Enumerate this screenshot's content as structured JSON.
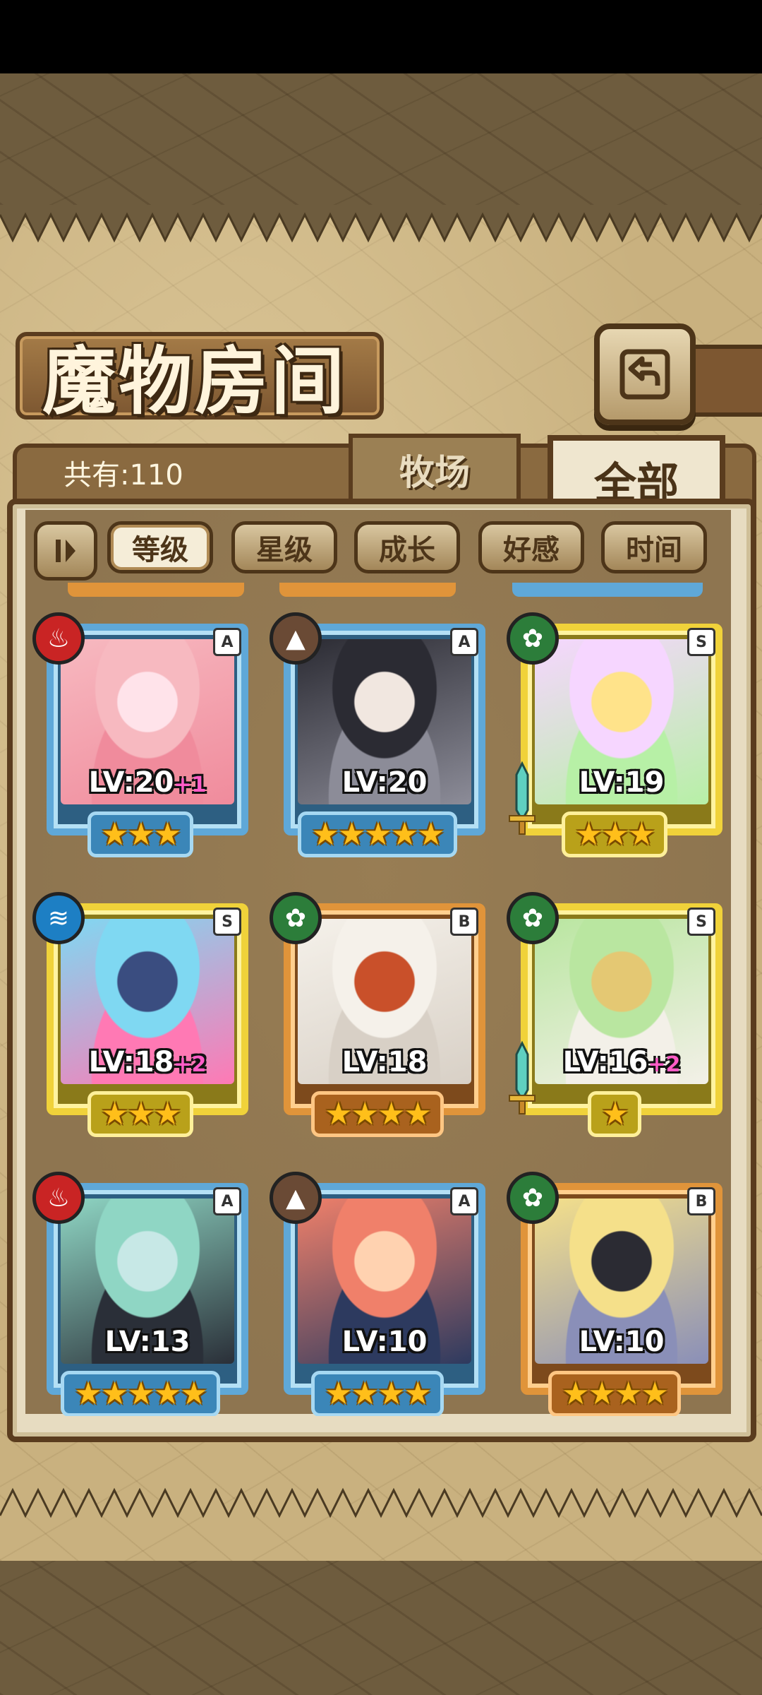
{
  "title": "魔物房间",
  "count_label": "共有:110",
  "tabs": [
    {
      "label": "牧场",
      "active": false
    },
    {
      "label": "全部",
      "active": true
    }
  ],
  "sort_buttons": [
    {
      "label": "等级",
      "active": true
    },
    {
      "label": "星级",
      "active": false
    },
    {
      "label": "成长",
      "active": false
    },
    {
      "label": "好感",
      "active": false
    },
    {
      "label": "时间",
      "active": false
    }
  ],
  "sort_toggle_icon": "sort-order-icon",
  "back_icon": "back-arrow-icon",
  "monsters": [
    {
      "element": "fire",
      "rank": "A",
      "level": "LV:20",
      "bonus": "+1",
      "stars": 3,
      "weapon": false,
      "palette": [
        "#f7b9c0",
        "#f08b9c",
        "#ffe3ea"
      ]
    },
    {
      "element": "earth",
      "rank": "A",
      "level": "LV:20",
      "bonus": "",
      "stars": 5,
      "weapon": false,
      "palette": [
        "#2b2b33",
        "#8c8c98",
        "#f1e7e0"
      ]
    },
    {
      "element": "wood",
      "rank": "S",
      "level": "LV:19",
      "bonus": "",
      "stars": 3,
      "weapon": true,
      "palette": [
        "#f6d6ff",
        "#b7f0a6",
        "#ffe38a"
      ]
    },
    {
      "element": "water",
      "rank": "S",
      "level": "LV:18",
      "bonus": "+2",
      "stars": 3,
      "weapon": false,
      "palette": [
        "#7fd8f2",
        "#ff79b4",
        "#3a4d80"
      ]
    },
    {
      "element": "wood",
      "rank": "B",
      "level": "LV:18",
      "bonus": "",
      "stars": 4,
      "weapon": false,
      "palette": [
        "#f5f1ea",
        "#d8d0c6",
        "#c9502a"
      ]
    },
    {
      "element": "wood",
      "rank": "S",
      "level": "LV:16",
      "bonus": "+2",
      "stars": 1,
      "weapon": true,
      "palette": [
        "#b9e6a0",
        "#f3f0e8",
        "#e4c873"
      ]
    },
    {
      "element": "fire",
      "rank": "A",
      "level": "LV:13",
      "bonus": "",
      "stars": 5,
      "weapon": false,
      "palette": [
        "#8fd6c4",
        "#2a2f38",
        "#c7e8e6"
      ]
    },
    {
      "element": "earth",
      "rank": "A",
      "level": "LV:10",
      "bonus": "",
      "stars": 4,
      "weapon": false,
      "palette": [
        "#f0806a",
        "#2d3a5f",
        "#ffd2b0"
      ]
    },
    {
      "element": "wood",
      "rank": "B",
      "level": "LV:10",
      "bonus": "",
      "stars": 4,
      "weapon": false,
      "palette": [
        "#f5e08a",
        "#8a8fb8",
        "#2b2b33"
      ]
    }
  ]
}
